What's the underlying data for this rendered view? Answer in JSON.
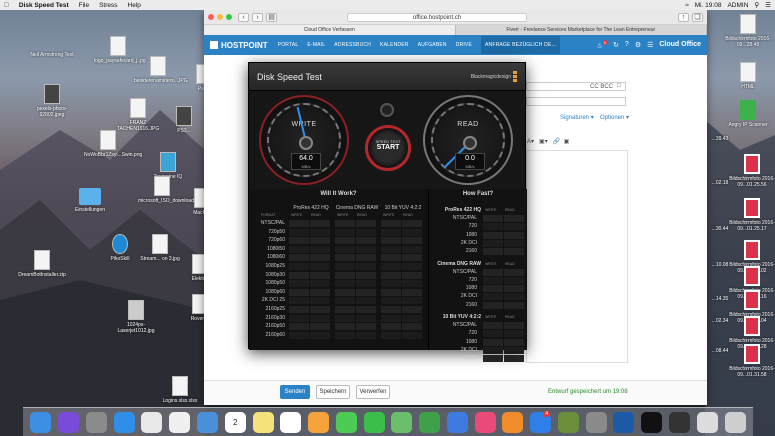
{
  "menubar": {
    "app": "Disk Speed Test",
    "items": [
      "File",
      "Stress",
      "Help"
    ],
    "clock": "Mi. 19:08",
    "user": "ADMIN"
  },
  "desktop_icons_left": [
    {
      "label": "Neil Armstrong Text"
    },
    {
      "label": "logo_paysafecard_j..pg"
    },
    {
      "label": "besiderenamiders...JPG"
    },
    {
      "label": "Pay..."
    },
    {
      "label": "pexels-photo-92802.jpeg"
    },
    {
      "label": "FRANZ TACHEN1916.JPG"
    },
    {
      "label": "PS3..."
    },
    {
      "label": "NoWoBbr1Zsyi...Swin.png"
    },
    {
      "label": "Tangerine IQ"
    },
    {
      "label": "Einstellungen"
    },
    {
      "label": "microsoft_ISO_download_tool.exe"
    },
    {
      "label": "MacF...."
    },
    {
      "label": "PikoSkill"
    },
    {
      "label": "iCloud Drive (Archiv)"
    },
    {
      "label": "Stream... on 3.jpg"
    },
    {
      "label": "Elektr..."
    },
    {
      "label": "DreamBotInstaller.zip"
    },
    {
      "label": "1024px-Laserjet1012.jpg"
    },
    {
      "label": "Roven..."
    },
    {
      "label": "Logins.xlsx.xlsx"
    }
  ],
  "desktop_icons_right": [
    {
      "label": "Bildschirmfoto 2016-09...28.48"
    },
    {
      "label": "HTML"
    },
    {
      "label": "Angry IP Scanner"
    },
    {
      "label": "...39.43"
    },
    {
      "label": "...02.18"
    },
    {
      "label": "Bildschirmfoto 2016-09...01.25.56"
    },
    {
      "label": "Bildschirmfoto 2016-09...01.25.17"
    },
    {
      "label": "...30.44"
    },
    {
      "label": "Bildschirmfoto 2016-09...01.26.02"
    },
    {
      "label": "...10.08"
    },
    {
      "label": "Bildschirmfoto 2016-09...01.26.16"
    },
    {
      "label": "...14.35"
    },
    {
      "label": "Bildschirmfoto 2016-09...01.27.04"
    },
    {
      "label": "...02.34"
    },
    {
      "label": "Bildschirmfoto 2016-09...01.31.28"
    },
    {
      "label": "...08.44"
    },
    {
      "label": "Bildschirmfoto 2016-09...01.31.58"
    }
  ],
  "browser": {
    "address": "office.hostpoint.ch",
    "tabs": [
      "Cloud Office Verfassen",
      "Fiverr - Freelance Services Marketplace for The Lean Entrepreneur"
    ],
    "brand": "HOSTPOINT",
    "nav": [
      "PORTAL",
      "E-MAIL",
      "ADRESSBUCH",
      "KALENDER",
      "AUFGABEN",
      "DRIVE",
      "ANFRAGE BEZÜGLICH DE..."
    ],
    "notification_count": "5",
    "cloud_label": "Cloud Office",
    "cc_bcc": "CC  BCC",
    "signatures": "Signaturen ▾",
    "options": "Optionen ▾",
    "send": "Senden",
    "save": "Speichern",
    "discard": "Verwerfen",
    "draft_status": "Entwurf gespeichert um 19:08"
  },
  "dst": {
    "title": "Disk Speed Test",
    "brand": "Blackmagicdesign",
    "write": {
      "label": "WRITE",
      "value": "64.0",
      "unit": "MB/s",
      "fraction": 0.45
    },
    "read": {
      "label": "READ",
      "value": "0.0",
      "unit": "MB/s",
      "fraction": 0.0
    },
    "start_sub": "SPEED TEST",
    "start_main": "START",
    "left_title": "Will It Work?",
    "right_title": "How Fast?",
    "format_header": "FORMAT",
    "codecs": [
      "ProRes 422 HQ",
      "Cinema DNG RAW",
      "10 Bit YUV 4:2:2"
    ],
    "wr": [
      "WRITE",
      "READ"
    ],
    "formats": [
      "NTSC/PAL",
      "720p50",
      "720p60",
      "1080i50",
      "1080i60",
      "1080p25",
      "1080p30",
      "1080p50",
      "1080p60",
      "2K DCI 25",
      "2160p25",
      "2160p30",
      "2160p50",
      "2160p60"
    ],
    "fast_groups": [
      {
        "name": "ProRes 422 HQ",
        "rows": [
          "NTSC/PAL",
          "720",
          "1080",
          "2K DCI",
          "2160"
        ]
      },
      {
        "name": "Cinema DNG RAW",
        "rows": [
          "NTSC/PAL",
          "720",
          "1080",
          "2K DCI",
          "2160"
        ]
      },
      {
        "name": "10 Bit YUV 4:2:2",
        "rows": [
          "NTSC/PAL",
          "720",
          "1080",
          "2K DCI",
          "2160"
        ]
      }
    ]
  },
  "dock": {
    "apps": [
      "finder-icon",
      "siri-icon",
      "launchpad-icon",
      "safari-icon",
      "chrome-icon",
      "photos-icon",
      "mail-icon",
      "calendar-icon",
      "notes-icon",
      "reminders-icon",
      "photo-icon",
      "messages-icon",
      "facetime-icon",
      "maps-icon",
      "numbers-icon",
      "keynote-icon",
      "itunes-icon",
      "ibooks-icon",
      "appstore-icon",
      "minecraft-icon",
      "system-preferences-icon",
      "virtualbox-icon",
      "terminal-icon",
      "disk-speed-icon",
      "downloads-icon",
      "trash-icon"
    ],
    "calendar_day": "2",
    "appstore_badge": "4"
  }
}
